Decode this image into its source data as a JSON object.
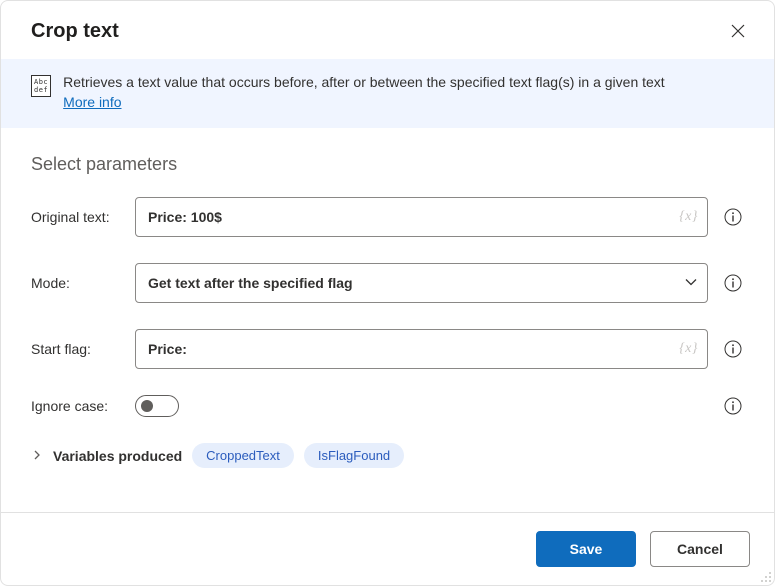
{
  "header": {
    "title": "Crop text"
  },
  "banner": {
    "icon_lines": "Abc\ndef",
    "description": "Retrieves a text value that occurs before, after or between the specified text flag(s) in a given text",
    "link_label": "More info"
  },
  "section": {
    "title": "Select parameters"
  },
  "fields": {
    "original_text": {
      "label": "Original text:",
      "value": "Price: 100$"
    },
    "mode": {
      "label": "Mode:",
      "value": "Get text after the specified flag"
    },
    "start_flag": {
      "label": "Start flag:",
      "value": "Price:"
    },
    "ignore_case": {
      "label": "Ignore case:",
      "on": false
    }
  },
  "fx_token": "{x}",
  "variables": {
    "label": "Variables produced",
    "chips": [
      "CroppedText",
      "IsFlagFound"
    ]
  },
  "footer": {
    "save": "Save",
    "cancel": "Cancel"
  }
}
